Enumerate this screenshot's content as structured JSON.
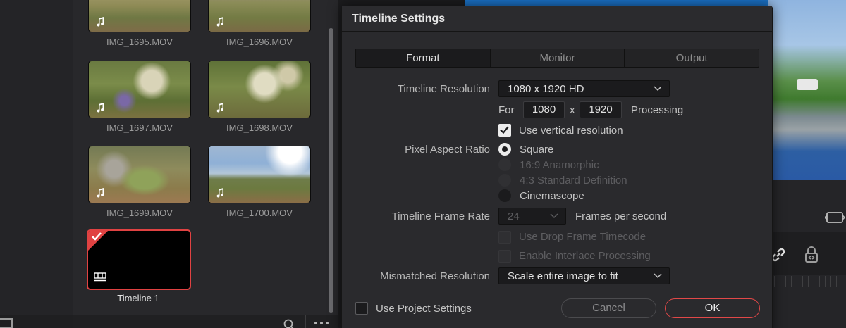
{
  "media_pool": {
    "clips": [
      {
        "name": "IMG_1695.MOV"
      },
      {
        "name": "IMG_1696.MOV"
      },
      {
        "name": "IMG_1697.MOV"
      },
      {
        "name": "IMG_1698.MOV"
      },
      {
        "name": "IMG_1699.MOV"
      },
      {
        "name": "IMG_1700.MOV"
      },
      {
        "name": "Timeline 1"
      }
    ]
  },
  "dialog": {
    "title": "Timeline Settings",
    "tabs": [
      "Format",
      "Monitor",
      "Output"
    ],
    "active_tab": "Format",
    "timeline_resolution": {
      "label": "Timeline Resolution",
      "value": "1080 x 1920 HD",
      "for_label": "For",
      "width": "1080",
      "x_label": "x",
      "height": "1920",
      "processing_label": "Processing",
      "use_vertical_label": "Use vertical resolution",
      "use_vertical_checked": true
    },
    "pixel_aspect_ratio": {
      "label": "Pixel Aspect Ratio",
      "options": [
        "Square",
        "16:9 Anamorphic",
        "4:3 Standard Definition",
        "Cinemascope"
      ],
      "selected": "Square"
    },
    "frame_rate": {
      "label": "Timeline Frame Rate",
      "value": "24",
      "unit": "Frames per second",
      "drop_frame_label": "Use Drop Frame Timecode",
      "interlace_label": "Enable Interlace Processing"
    },
    "mismatched_resolution": {
      "label": "Mismatched Resolution",
      "value": "Scale entire image to fit"
    },
    "use_project_settings_label": "Use Project Settings",
    "cancel_label": "Cancel",
    "ok_label": "OK"
  },
  "colors": {
    "accent": "#e14848",
    "dialog_bg": "#2a2a2d",
    "panel_bg": "#28282b",
    "field_bg": "#1b1b1d"
  },
  "icons": [
    "music-note-icon",
    "checkmark-icon",
    "timeline-icon",
    "search-icon",
    "more-icon",
    "chevron-down-icon",
    "fit-icon",
    "link-icon",
    "lock-icon"
  ]
}
